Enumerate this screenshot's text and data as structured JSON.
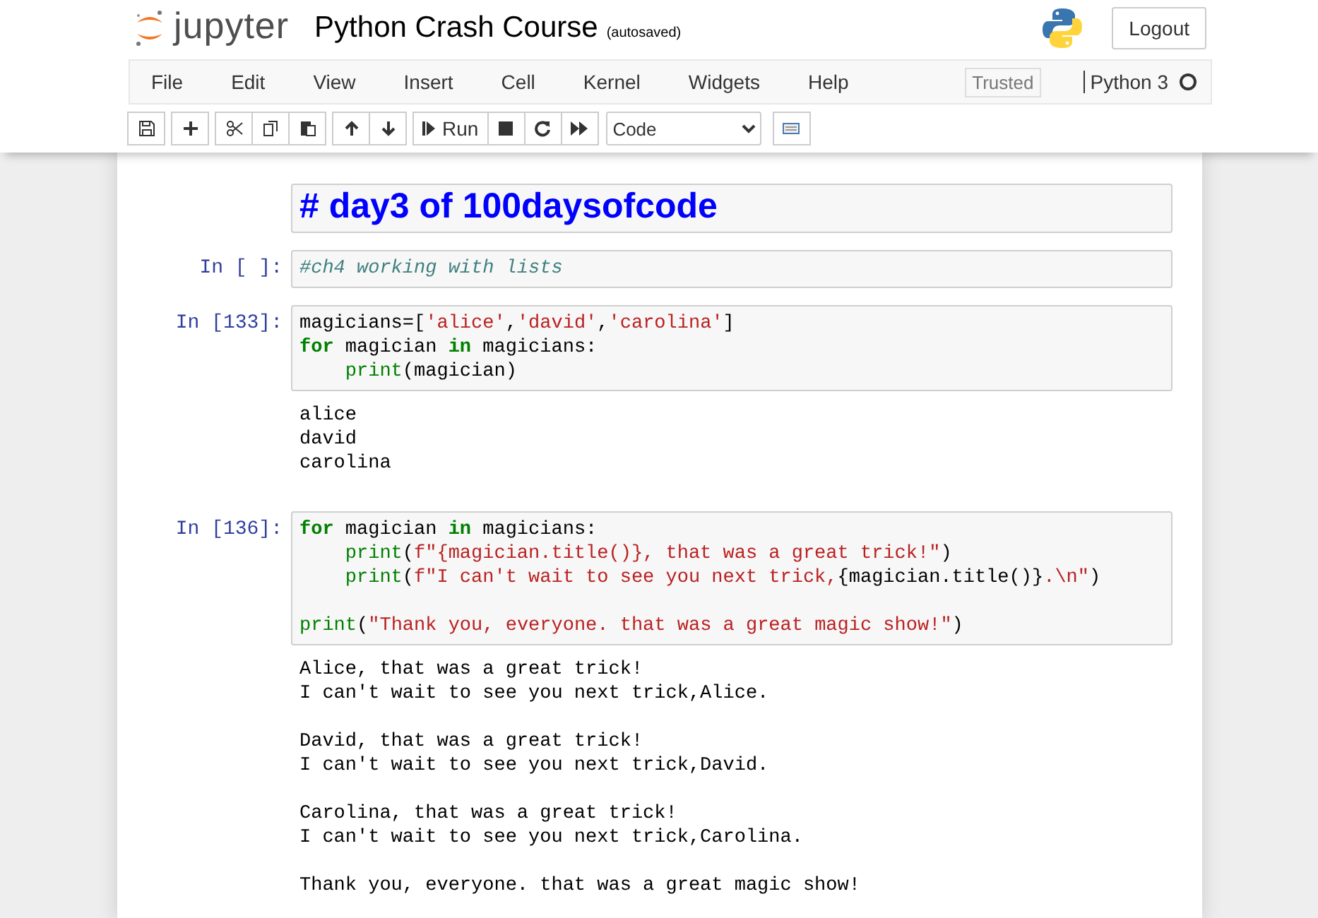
{
  "header": {
    "logo_text": "jupyter",
    "notebook_title": "Python Crash Course",
    "save_status": "(autosaved)",
    "logout": "Logout"
  },
  "menu": {
    "items": [
      "File",
      "Edit",
      "View",
      "Insert",
      "Cell",
      "Kernel",
      "Widgets",
      "Help"
    ],
    "trusted": "Trusted",
    "kernel_name": "Python 3",
    "kernel_busy": false
  },
  "toolbar": {
    "run_label": "Run",
    "cell_type": "Code"
  },
  "cells": [
    {
      "kind": "markdown",
      "text": "# day3 of 100daysofcode"
    },
    {
      "kind": "code",
      "prompt": "In [ ]:",
      "lines": [
        {
          "indented": false,
          "blank_before": false,
          "tokens": [
            {
              "kind": "comment",
              "text": "#ch4 working with lists"
            }
          ]
        }
      ]
    },
    {
      "kind": "code",
      "prompt": "In [133]:",
      "lines": [
        {
          "indented": false,
          "blank_before": false,
          "tokens": [
            {
              "kind": "text",
              "text": "magicians=["
            },
            {
              "kind": "string",
              "text": "'alice'"
            },
            {
              "kind": "text",
              "text": ","
            },
            {
              "kind": "string",
              "text": "'david'"
            },
            {
              "kind": "text",
              "text": ","
            },
            {
              "kind": "string",
              "text": "'carolina'"
            },
            {
              "kind": "text",
              "text": "]"
            }
          ]
        },
        {
          "indented": false,
          "blank_before": false,
          "tokens": [
            {
              "kind": "keyword",
              "text": "for"
            },
            {
              "kind": "text",
              "text": " magician "
            },
            {
              "kind": "keyword",
              "text": "in"
            },
            {
              "kind": "text",
              "text": " magicians:"
            }
          ]
        },
        {
          "indented": true,
          "blank_before": false,
          "tokens": [
            {
              "kind": "builtin",
              "text": "print"
            },
            {
              "kind": "text",
              "text": "(magician)"
            }
          ]
        }
      ],
      "output": [
        [
          "alice",
          "david",
          "carolina"
        ]
      ]
    },
    {
      "kind": "code",
      "prompt": "In [136]:",
      "lines": [
        {
          "indented": false,
          "blank_before": false,
          "tokens": [
            {
              "kind": "keyword",
              "text": "for"
            },
            {
              "kind": "text",
              "text": " magician "
            },
            {
              "kind": "keyword",
              "text": "in"
            },
            {
              "kind": "text",
              "text": " magicians:"
            }
          ]
        },
        {
          "indented": true,
          "blank_before": false,
          "tokens": [
            {
              "kind": "builtin",
              "text": "print"
            },
            {
              "kind": "text",
              "text": "("
            },
            {
              "kind": "string",
              "text": "f\"{magician.title()}, that was a great trick!\""
            },
            {
              "kind": "text",
              "text": ")"
            }
          ]
        },
        {
          "indented": true,
          "blank_before": false,
          "tokens": [
            {
              "kind": "builtin",
              "text": "print"
            },
            {
              "kind": "text",
              "text": "("
            },
            {
              "kind": "string",
              "text": "f\"I can't wait to see you next trick,"
            },
            {
              "kind": "text",
              "text": "{magician.title()}"
            },
            {
              "kind": "string",
              "text": ".\\n\""
            },
            {
              "kind": "text",
              "text": ")"
            }
          ]
        },
        {
          "indented": false,
          "blank_before": true,
          "tokens": [
            {
              "kind": "builtin",
              "text": "print"
            },
            {
              "kind": "text",
              "text": "("
            },
            {
              "kind": "string",
              "text": "\"Thank you, everyone. that was a great magic show!\""
            },
            {
              "kind": "text",
              "text": ")"
            }
          ]
        }
      ],
      "output": [
        [
          "Alice, that was a great trick!",
          "I can't wait to see you next trick,Alice."
        ],
        [
          "David, that was a great trick!",
          "I can't wait to see you next trick,David."
        ],
        [
          "Carolina, that was a great trick!",
          "I can't wait to see you next trick,Carolina."
        ],
        [
          "Thank you, everyone. that was a great magic show!"
        ]
      ]
    }
  ]
}
